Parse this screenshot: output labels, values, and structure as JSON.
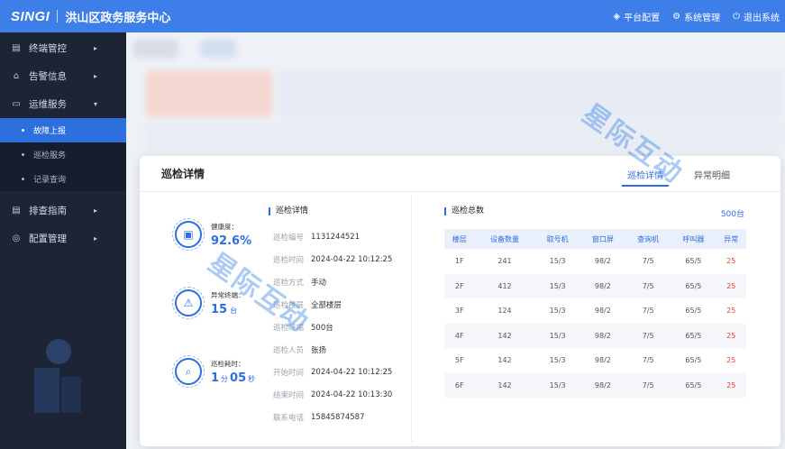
{
  "header": {
    "logo": "SINGI",
    "title": "洪山区政务服务中心",
    "actions": [
      {
        "icon": "platform-config-icon",
        "glyph": "◈",
        "label": "平台配置"
      },
      {
        "icon": "system-settings-icon",
        "glyph": "⚙",
        "label": "系统管理"
      },
      {
        "icon": "logout-icon",
        "glyph": "⏻",
        "label": "退出系统"
      }
    ]
  },
  "sidebar": {
    "items": [
      {
        "label": "终端管控",
        "glyph": "▤"
      },
      {
        "label": "告警信息",
        "glyph": "⌂"
      },
      {
        "label": "运维服务",
        "glyph": "▭"
      },
      {
        "label": "排查指南",
        "glyph": "▤"
      },
      {
        "label": "配置管理",
        "glyph": "◎"
      }
    ],
    "sub_items": [
      {
        "label": "故障上报",
        "active": true
      },
      {
        "label": "巡检服务",
        "active": false
      },
      {
        "label": "记录查询",
        "active": false
      }
    ]
  },
  "modal": {
    "title": "巡检详情",
    "tabs": [
      {
        "label": "巡检详情",
        "active": true
      },
      {
        "label": "异常明细",
        "active": false
      }
    ],
    "stats": {
      "health": {
        "label": "健康度：",
        "value": "92.6%"
      },
      "abnormal": {
        "label": "异常终端：",
        "value": "15",
        "unit": "台"
      },
      "duration": {
        "label": "巡检耗时：",
        "minutes": "1",
        "min_unit": "分",
        "seconds": "05",
        "sec_unit": "秒"
      }
    },
    "detail_title": "巡检详情",
    "details": [
      {
        "key": "巡检编号",
        "value": "1131244521"
      },
      {
        "key": "巡检时间",
        "value": "2024-04-22 10:12:25"
      },
      {
        "key": "巡检方式",
        "value": "手动"
      },
      {
        "key": "巡检楼层",
        "value": "全部楼层"
      },
      {
        "key": "巡检终端",
        "value": "500台"
      },
      {
        "key": "巡检人员",
        "value": "张扬"
      },
      {
        "key": "开始时间",
        "value": "2024-04-22 10:12:25"
      },
      {
        "key": "结束时间",
        "value": "2024-04-22 10:13:30"
      },
      {
        "key": "联系电话",
        "value": "15845874587"
      }
    ],
    "table": {
      "title": "巡检总数",
      "total": "500台",
      "headers": [
        "楼层",
        "设备数量",
        "取号机",
        "窗口屏",
        "查询机",
        "呼叫器",
        "异常"
      ],
      "rows": [
        [
          "1F",
          "241",
          "15/3",
          "98/2",
          "7/5",
          "65/5",
          "25"
        ],
        [
          "2F",
          "412",
          "15/3",
          "98/2",
          "7/5",
          "65/5",
          "25"
        ],
        [
          "3F",
          "124",
          "15/3",
          "98/2",
          "7/5",
          "65/5",
          "25"
        ],
        [
          "4F",
          "142",
          "15/3",
          "98/2",
          "7/5",
          "65/5",
          "25"
        ],
        [
          "5F",
          "142",
          "15/3",
          "98/2",
          "7/5",
          "65/5",
          "25"
        ],
        [
          "6F",
          "142",
          "15/3",
          "98/2",
          "7/5",
          "65/5",
          "25"
        ]
      ]
    }
  },
  "watermark": "星际互动",
  "colors": {
    "primary": "#2e6fde",
    "topbar": "#3d7ee8",
    "sidebar": "#1c2436",
    "danger": "#e2413c"
  }
}
